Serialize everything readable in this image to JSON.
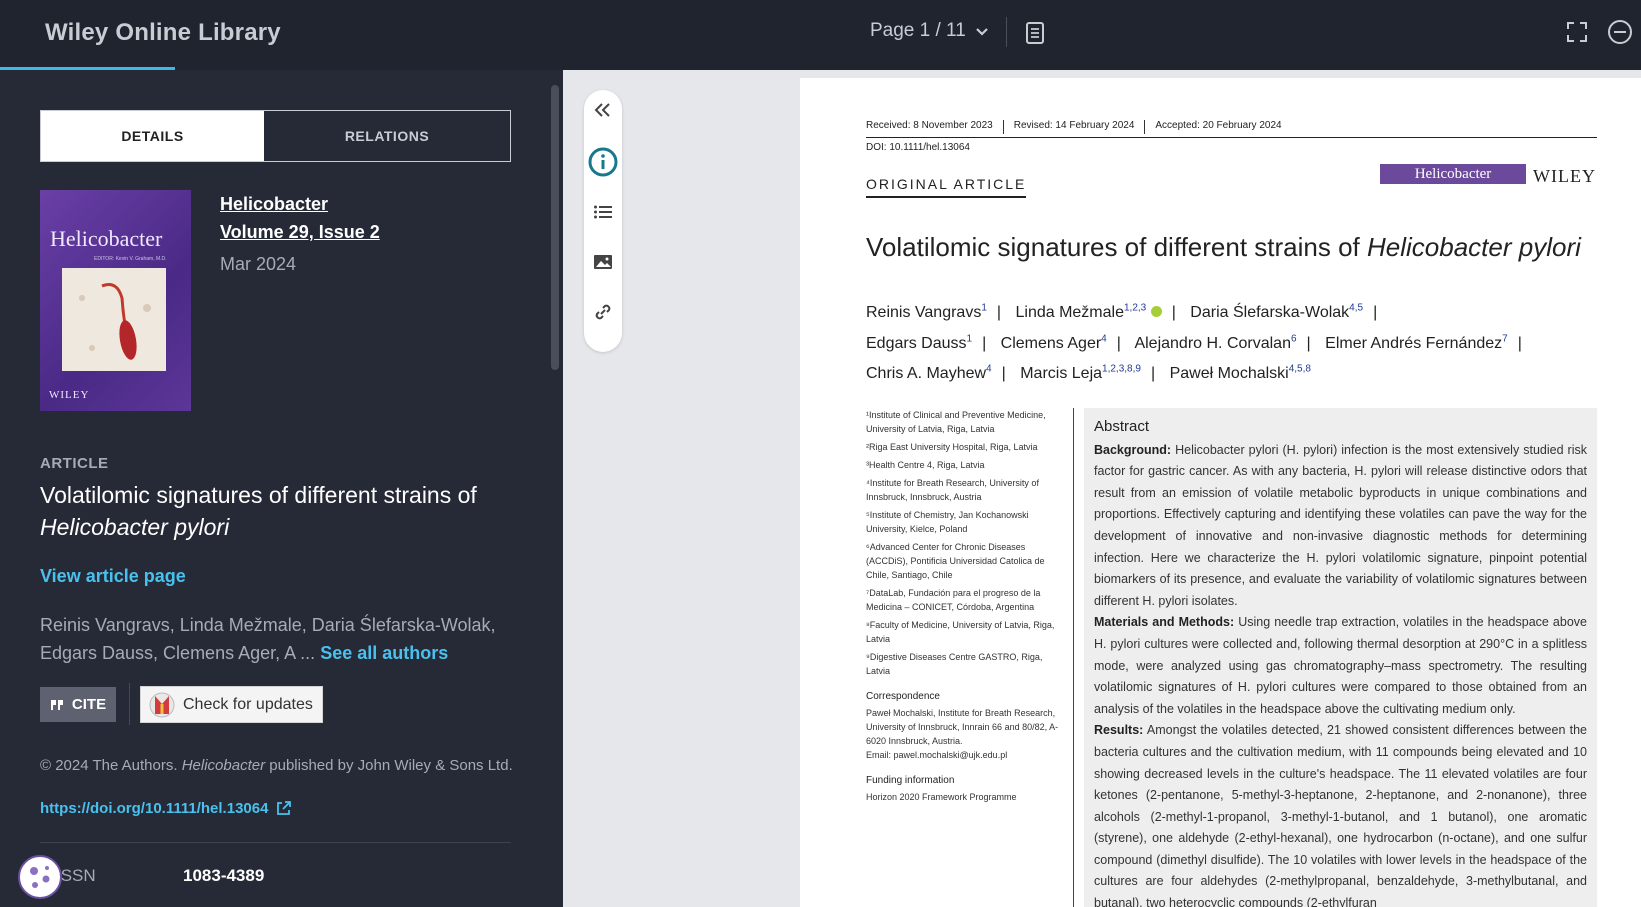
{
  "header": {
    "brand": "Wiley Online Library",
    "page_indicator": "Page 1 / 11"
  },
  "details": {
    "tabs": [
      "DETAILS",
      "RELATIONS"
    ],
    "cover": {
      "title": "Helicobacter",
      "editor": "EDITOR: Kevin V. Graham, M.D.",
      "publisher": "WILEY"
    },
    "journal_name": "Helicobacter",
    "journal_volume": "Volume 29, Issue 2",
    "journal_date": "Mar 2024",
    "article_label": "ARTICLE",
    "article_title_1": "Volatilomic signatures of different strains of",
    "article_title_2": "Helicobacter pylori",
    "view_article": "View article page",
    "authors_preview": "Reinis Vangravs, Linda Mežmale, Daria Ślefarska-Wolak, Edgars Dauss, Clemens Ager, A",
    "authors_ellipsis": "...",
    "see_all": "See all authors",
    "cite_label": "CITE",
    "check_updates": "Check for updates",
    "copyright_1": "© 2024 The Authors.",
    "copyright_journal": "Helicobacter",
    "copyright_2": "published by John Wiley & Sons Ltd.",
    "doi_link": "https://doi.org/10.1111/hel.13064",
    "issn_label": "ISSN",
    "issn_value": "1083-4389"
  },
  "paper": {
    "received": "Received: 8 November 2023",
    "revised": "Revised: 14 February 2024",
    "accepted": "Accepted: 20 February 2024",
    "doi": "DOI: 10.1111/hel.13064",
    "section": "ORIGINAL ARTICLE",
    "journal_logo": "Helicobacter",
    "publisher_logo": "WILEY",
    "title_plain": "Volatilomic signatures of different strains of",
    "title_italic": "Helicobacter pylori",
    "authors": [
      {
        "name": "Reinis Vangravs",
        "sup": "1"
      },
      {
        "name": "Linda Mežmale",
        "sup": "1,2,3"
      },
      {
        "name": "Daria Ślefarska-Wolak",
        "sup": "4,5"
      },
      {
        "name": "Edgars Dauss",
        "sup": "1"
      },
      {
        "name": "Clemens Ager",
        "sup": "4"
      },
      {
        "name": "Alejandro H. Corvalan",
        "sup": "6"
      },
      {
        "name": "Elmer Andrés Fernández",
        "sup": "7"
      },
      {
        "name": "Chris A. Mayhew",
        "sup": "4"
      },
      {
        "name": "Marcis Leja",
        "sup": "1,2,3,8,9"
      },
      {
        "name": "Paweł Mochalski",
        "sup": "4,5,8"
      }
    ],
    "affiliations": [
      "¹Institute of Clinical and Preventive Medicine, University of Latvia, Riga, Latvia",
      "²Riga East University Hospital, Riga, Latvia",
      "³Health Centre 4, Riga, Latvia",
      "⁴Institute for Breath Research, University of Innsbruck, Innsbruck, Austria",
      "⁵Institute of Chemistry, Jan Kochanowski University, Kielce, Poland",
      "⁶Advanced Center for Chronic Diseases (ACCDiS), Pontificia Universidad Catolica de Chile, Santiago, Chile",
      "⁷DataLab, Fundación para el progreso de la Medicina – CONICET, Córdoba, Argentina",
      "⁸Faculty of Medicine, University of Latvia, Riga, Latvia",
      "⁹Digestive Diseases Centre GASTRO, Riga, Latvia"
    ],
    "correspondence_head": "Correspondence",
    "correspondence": "Paweł Mochalski, Institute for Breath Research, University of Innsbruck, Innrain 66 and 80/82, A-6020 Innsbruck, Austria.",
    "email": "Email: pawel.mochalski@ujk.edu.pl",
    "funding_head": "Funding information",
    "funding": "Horizon 2020 Framework Programme",
    "abstract_head": "Abstract",
    "bg_label": "Background:",
    "bg_text": "Helicobacter pylori (H. pylori) infection is the most extensively studied risk factor for gastric cancer. As with any bacteria, H. pylori will release distinctive odors that result from an emission of volatile metabolic byproducts in unique combinations and proportions. Effectively capturing and identifying these volatiles can pave the way for the development of innovative and non-invasive diagnostic methods for determining infection. Here we characterize the H. pylori volatilomic signature, pinpoint potential biomarkers of its presence, and evaluate the variability of volatilomic signatures between different H. pylori isolates.",
    "mm_label": "Materials and Methods:",
    "mm_text": "Using needle trap extraction, volatiles in the headspace above H. pylori cultures were collected and, following thermal desorption at 290°C in a splitless mode, were analyzed using gas chromatography–mass spectrometry. The resulting volatilomic signatures of H. pylori cultures were compared to those obtained from an analysis of the volatiles in the headspace above the cultivating medium only.",
    "res_label": "Results:",
    "res_text": "Amongst the volatiles detected, 21 showed consistent differences between the bacteria cultures and the cultivation medium, with 11 compounds being elevated and 10 showing decreased levels in the culture's headspace. The 11 elevated volatiles are four ketones (2-pentanone, 5-methyl-3-heptanone, 2-heptanone, and 2-nonanone), three alcohols (2-methyl-1-propanol, 3-methyl-1-butanol, and 1 butanol), one aromatic (styrene), one aldehyde (2-ethyl-hexanal), one hydrocarbon (n-octane), and one sulfur compound (dimethyl disulfide). The 10 volatiles with lower levels in the headspace of the cultures are four aldehydes (2-methylpropanal, benzaldehyde, 3-methylbutanal, and butanal), two heterocyclic compounds (2-ethylfuran"
  }
}
